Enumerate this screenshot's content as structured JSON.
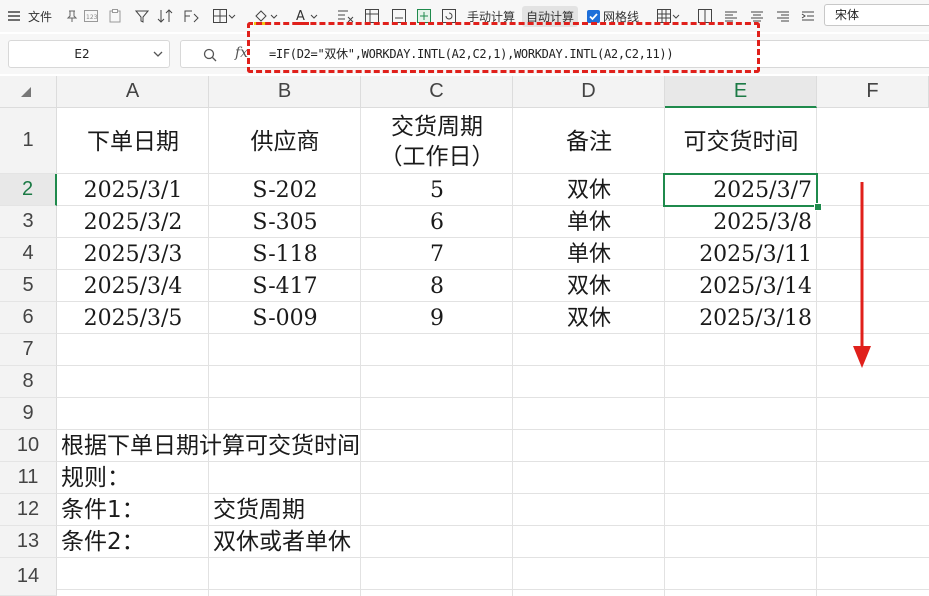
{
  "toolbar": {
    "file_label": "文件",
    "manual_calc_label": "手动计算",
    "auto_calc_label": "自动计算",
    "gridlines_label": "网格线",
    "font_name": "宋体",
    "accent_color": "#e0201b",
    "highlight_color": "#f2c511"
  },
  "formula_bar": {
    "name_box": "E2",
    "fx_label": "fx",
    "formula": "=IF(D2=\"双休\",WORKDAY.INTL(A2,C2,1),WORKDAY.INTL(A2,C2,11))"
  },
  "columns": [
    "A",
    "B",
    "C",
    "D",
    "E",
    "F"
  ],
  "rows": [
    "1",
    "2",
    "3",
    "4",
    "5",
    "6",
    "7",
    "8",
    "9",
    "10",
    "11",
    "12",
    "13",
    "14"
  ],
  "header_row": {
    "a": "下单日期",
    "b": "供应商",
    "c_line1": "交货周期",
    "c_line2": "（工作日）",
    "d": "备注",
    "e": "可交货时间"
  },
  "data_rows": [
    {
      "a": "2025/3/1",
      "b": "S-202",
      "c": "5",
      "d": "双休",
      "e": "2025/3/7"
    },
    {
      "a": "2025/3/2",
      "b": "S-305",
      "c": "6",
      "d": "单休",
      "e": "2025/3/8"
    },
    {
      "a": "2025/3/3",
      "b": "S-118",
      "c": "7",
      "d": "单休",
      "e": "2025/3/11"
    },
    {
      "a": "2025/3/4",
      "b": "S-417",
      "c": "8",
      "d": "双休",
      "e": "2025/3/14"
    },
    {
      "a": "2025/3/5",
      "b": "S-009",
      "c": "9",
      "d": "双休",
      "e": "2025/3/18"
    }
  ],
  "notes": {
    "row10": "根据下单日期计算可交货时间",
    "row11": "规则：",
    "row12_label": "条件1：",
    "row12_value": "交货周期",
    "row13_label": "条件2：",
    "row13_value": "双休或者单休"
  },
  "selection": {
    "cell": "E2",
    "color": "#1f8a4c"
  }
}
